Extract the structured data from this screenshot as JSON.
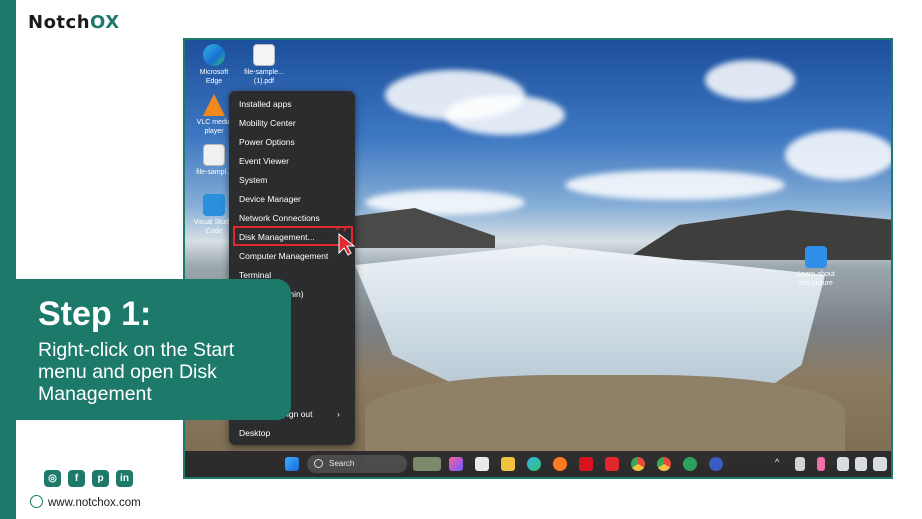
{
  "brand": {
    "logo_text_a": "Notch",
    "logo_text_b": "O",
    "logo_text_c": "X",
    "accent_color": "#1d7a6b"
  },
  "step": {
    "title": "Step 1:",
    "description": "Right-click on the Start menu and open Disk Management"
  },
  "desktop": {
    "icons": [
      {
        "label": "Microsoft Edge",
        "icon": "edge-icon"
      },
      {
        "label": "file-sample... (1).pdf",
        "icon": "pdf-file-icon"
      },
      {
        "label": "VLC media player",
        "icon": "vlc-icon"
      },
      {
        "label": "file-sampl...",
        "icon": "file-icon"
      },
      {
        "label": "Visual Studio Code",
        "icon": "vscode-icon"
      },
      {
        "label": "Learn about this picture",
        "icon": "info-icon"
      }
    ]
  },
  "context_menu": {
    "items": [
      "Installed apps",
      "Mobility Center",
      "Power Options",
      "Event Viewer",
      "System",
      "Device Manager",
      "Network Connections",
      "Disk Management...",
      "Computer Management",
      "Terminal",
      "min)",
      "ign out",
      "Desktop"
    ],
    "highlighted": "Disk Management...",
    "highlight_color": "#e0282e"
  },
  "taskbar": {
    "search_placeholder": "Search"
  },
  "footer": {
    "website": "www.notchox.com",
    "social": [
      "instagram-icon",
      "facebook-icon",
      "pinterest-icon",
      "linkedin-icon"
    ]
  }
}
